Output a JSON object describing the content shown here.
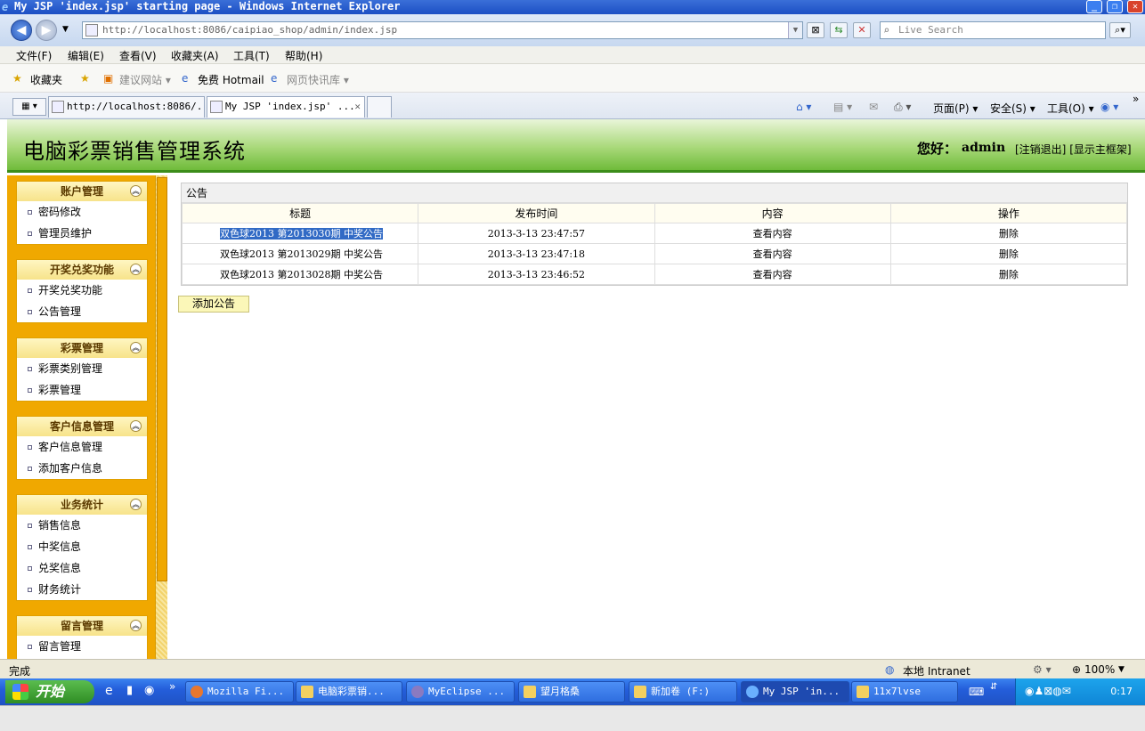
{
  "window": {
    "title": "My JSP 'index.jsp' starting page - Windows Internet Explorer"
  },
  "address": {
    "url": "http://localhost:8086/caipiao_shop/admin/index.jsp",
    "search_placeholder": "Live Search"
  },
  "menu": [
    "文件(F)",
    "编辑(E)",
    "查看(V)",
    "收藏夹(A)",
    "工具(T)",
    "帮助(H)"
  ],
  "favorites": {
    "label": "收藏夹",
    "items": [
      "建议网站 ▾",
      "免费 Hotmail",
      "网页快讯库 ▾"
    ]
  },
  "tabs": [
    {
      "label": "http://localhost:8086/..."
    },
    {
      "label": "My JSP 'index.jsp' ..."
    }
  ],
  "commands": {
    "page": "页面(P) ▾",
    "safety": "安全(S) ▾",
    "tools": "工具(O) ▾"
  },
  "page": {
    "system_title": "电脑彩票销售管理系统",
    "greeting": "您好：",
    "username": "admin",
    "logout": "[注销退出]",
    "show_frame": "[显示主框架]"
  },
  "sidebar": [
    {
      "title": "账户管理",
      "items": [
        "密码修改",
        "管理员维护"
      ]
    },
    {
      "title": "开奖兑奖功能",
      "items": [
        "开奖兑奖功能",
        "公告管理"
      ]
    },
    {
      "title": "彩票管理",
      "items": [
        "彩票类别管理",
        "彩票管理"
      ]
    },
    {
      "title": "客户信息管理",
      "items": [
        "客户信息管理",
        "添加客户信息"
      ]
    },
    {
      "title": "业务统计",
      "items": [
        "销售信息",
        "中奖信息",
        "兑奖信息",
        "财务统计"
      ]
    },
    {
      "title": "留言管理",
      "items": [
        "留言管理"
      ]
    }
  ],
  "notice": {
    "header": "公告",
    "columns": [
      "标题",
      "发布时间",
      "内容",
      "操作"
    ],
    "rows": [
      {
        "title": "双色球2013 第2013030期 中奖公告",
        "time": "2013-3-13 23:47:57",
        "content": "查看内容",
        "action": "删除"
      },
      {
        "title": "双色球2013 第2013029期 中奖公告",
        "time": "2013-3-13 23:47:18",
        "content": "查看内容",
        "action": "删除"
      },
      {
        "title": "双色球2013 第2013028期 中奖公告",
        "time": "2013-3-13 23:46:52",
        "content": "查看内容",
        "action": "删除"
      }
    ],
    "add_button": "添加公告"
  },
  "status": {
    "text": "完成",
    "zone": "本地 Intranet",
    "zoom": "100%"
  },
  "taskbar": {
    "start": "开始",
    "items": [
      "Mozilla Fi...",
      "电脑彩票销...",
      "MyEclipse ...",
      "望月格桑",
      "新加卷 (F:)",
      "My JSP 'in...",
      "11x7lvse"
    ],
    "clock": "0:17"
  }
}
